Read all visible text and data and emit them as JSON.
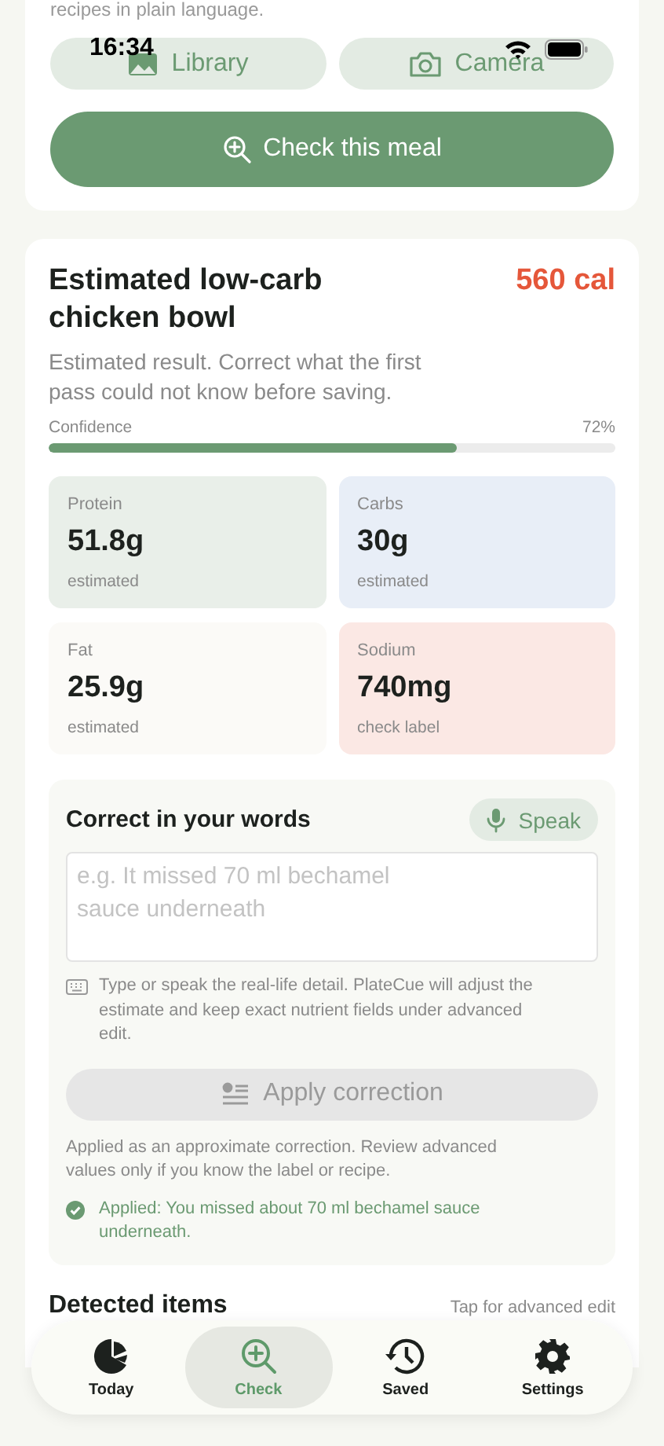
{
  "status_bar": {
    "time": "16:34"
  },
  "intro": {
    "text": "recipes in plain language."
  },
  "source_buttons": [
    {
      "kind": "library",
      "label": "Library"
    },
    {
      "kind": "camera",
      "label": "Camera"
    }
  ],
  "check_button": {
    "label": "Check this meal"
  },
  "result": {
    "title": "Estimated low-carb chicken bowl",
    "calories": "560 cal",
    "subtitle": "Estimated result. Correct what the first pass could not know before saving.",
    "confidence_label": "Confidence",
    "confidence_value": "72%",
    "level": 0.72
  },
  "nutrients": [
    {
      "name": "Protein",
      "value": "51.8g",
      "note": "estimated",
      "color": "#e9efe9"
    },
    {
      "name": "Carbs",
      "value": "30g",
      "note": "estimated",
      "color": "#e8eef7"
    },
    {
      "name": "Fat",
      "value": "25.9g",
      "note": "estimated",
      "color": "#fbfaf7"
    },
    {
      "name": "Sodium",
      "value": "740mg",
      "note": "check label",
      "color": "#fbe8e4"
    }
  ],
  "correction": {
    "title": "Correct in your words",
    "speak_label": "Speak",
    "placeholder": "e.g. It missed 70 ml bechamel sauce underneath",
    "hint": "Type or speak the real-life detail. PlateCue will adjust the estimate and keep exact nutrient fields under advanced edit.",
    "apply_label": "Apply correction",
    "apply_disabled": true,
    "note": "Applied as an approximate correction. Review advanced values only if you know the label or recipe.",
    "applied": "Applied: You missed about 70 ml bechamel sauce underneath."
  },
  "detected": {
    "title": "Detected items",
    "action": "Tap for advanced edit"
  },
  "tab_bar": [
    {
      "kind": "today",
      "label": "Today",
      "selected": false
    },
    {
      "kind": "check",
      "label": "Check",
      "selected": true
    },
    {
      "kind": "saved",
      "label": "Saved",
      "selected": false
    },
    {
      "kind": "settings",
      "label": "Settings",
      "selected": false
    }
  ]
}
